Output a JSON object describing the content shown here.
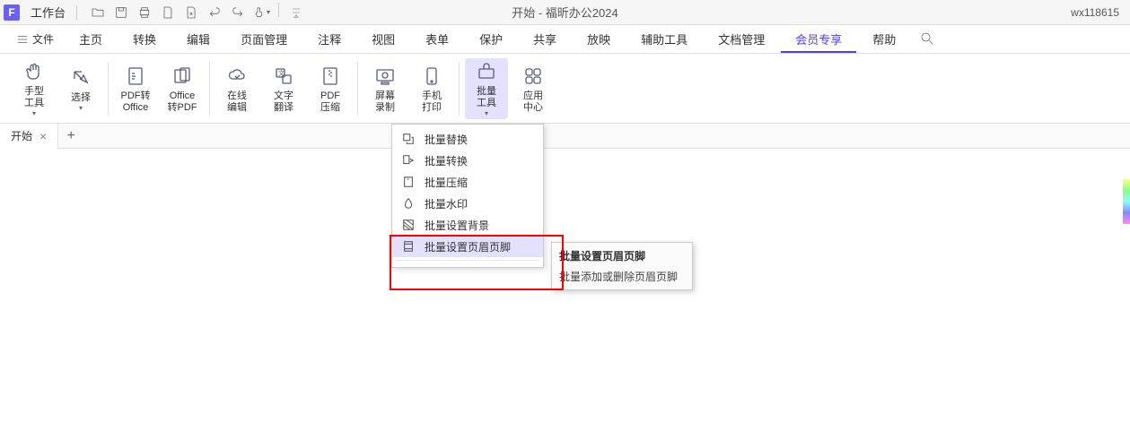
{
  "titlebar": {
    "worktab": "工作台",
    "title": "开始 - 福昕办公2024",
    "user": "wx118615"
  },
  "menubar": {
    "file": "文件",
    "items": [
      "主页",
      "转换",
      "编辑",
      "页面管理",
      "注释",
      "视图",
      "表单",
      "保护",
      "共享",
      "放映",
      "辅助工具",
      "文档管理",
      "会员专享",
      "帮助"
    ],
    "active_index": 12
  },
  "ribbon": {
    "hand": "手型\n工具",
    "select": "选择",
    "pdf2office": "PDF转\nOffice",
    "office2pdf": "Office\n转PDF",
    "online_edit": "在线\n编辑",
    "translate": "文字\n翻译",
    "compress": "PDF\n压缩",
    "screen_rec": "屏幕\n录制",
    "mobile_print": "手机\n打印",
    "batch_tools": "批量\n工具",
    "app_center": "应用\n中心"
  },
  "tabs": {
    "start": "开始"
  },
  "dropdown": {
    "items": [
      {
        "label": "批量替换"
      },
      {
        "label": "批量转换"
      },
      {
        "label": "批量压缩"
      },
      {
        "label": "批量水印"
      },
      {
        "label": "批量设置背景"
      },
      {
        "label": "批量设置页眉页脚"
      }
    ],
    "hover_index": 5
  },
  "tooltip": {
    "title": "批量设置页眉页脚",
    "desc": "批量添加或删除页眉页脚"
  }
}
